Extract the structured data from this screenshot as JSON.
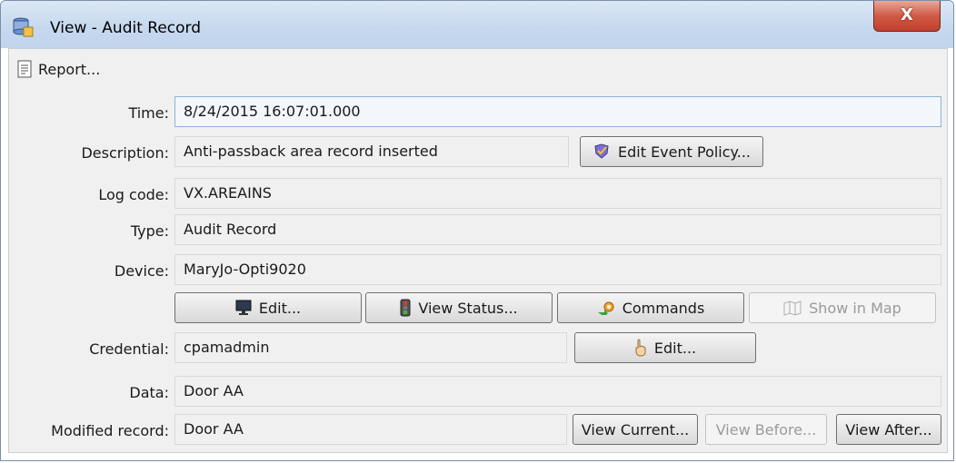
{
  "window": {
    "title": "View - Audit Record",
    "close_label": "X"
  },
  "toolbar": {
    "report_label": "Report..."
  },
  "fields": {
    "time": {
      "label": "Time:",
      "value": "8/24/2015 16:07:01.000"
    },
    "description": {
      "label": "Description:",
      "value": "Anti-passback area record inserted"
    },
    "log_code": {
      "label": "Log code:",
      "value": "VX.AREAINS"
    },
    "type": {
      "label": "Type:",
      "value": "Audit Record"
    },
    "device": {
      "label": "Device:",
      "value": "MaryJo-Opti9020"
    },
    "credential": {
      "label": "Credential:",
      "value": "cpamadmin"
    },
    "data": {
      "label": "Data:",
      "value": "Door AA"
    },
    "modified_record": {
      "label": "Modified record:",
      "value": "Door AA"
    }
  },
  "buttons": {
    "edit_event_policy": "Edit Event Policy...",
    "device_edit": "Edit...",
    "view_status": "View Status...",
    "commands": "Commands",
    "show_in_map": "Show in Map",
    "credential_edit": "Edit...",
    "view_current": "View Current...",
    "view_before": "View Before...",
    "view_after": "View After..."
  },
  "icons": {
    "title": "database-icon",
    "report": "report-document-icon",
    "edit_event_policy": "shield-check-icon",
    "device_edit": "monitor-icon",
    "view_status": "traffic-light-icon",
    "commands": "gear-arrow-icon",
    "show_in_map": "map-icon",
    "credential_edit": "hand-icon"
  }
}
